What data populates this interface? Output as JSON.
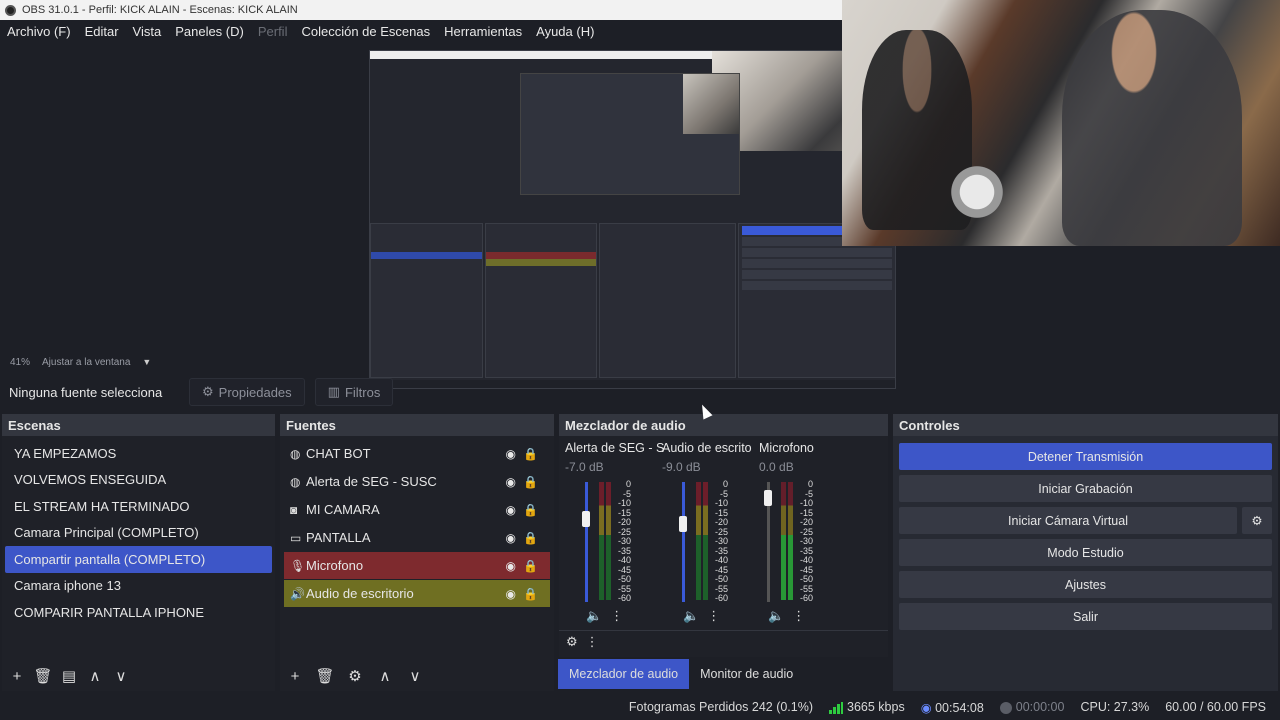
{
  "window": {
    "title": "OBS 31.0.1 - Perfil: KICK ALAIN - Escenas: KICK ALAIN"
  },
  "menu": [
    {
      "label": "Archivo (F)",
      "disabled": false
    },
    {
      "label": "Editar",
      "disabled": false
    },
    {
      "label": "Vista",
      "disabled": false
    },
    {
      "label": "Paneles (D)",
      "disabled": false
    },
    {
      "label": "Perfil",
      "disabled": true
    },
    {
      "label": "Colección de Escenas",
      "disabled": false
    },
    {
      "label": "Herramientas",
      "disabled": false
    },
    {
      "label": "Ayuda (H)",
      "disabled": false
    }
  ],
  "zoom": {
    "percent": "41%",
    "fit_label": "Ajustar a la ventana"
  },
  "source_bar": {
    "label": "Ninguna fuente selecciona",
    "properties": "Propiedades",
    "filters": "Filtros"
  },
  "scenes": {
    "title": "Escenas",
    "items": [
      {
        "label": "YA EMPEZAMOS",
        "selected": false
      },
      {
        "label": "VOLVEMOS ENSEGUIDA",
        "selected": false
      },
      {
        "label": "EL STREAM HA TERMINADO",
        "selected": false
      },
      {
        "label": "Camara Principal (COMPLETO)",
        "selected": false
      },
      {
        "label": "Compartir pantalla (COMPLETO)",
        "selected": true
      },
      {
        "label": "Camara iphone 13",
        "selected": false
      },
      {
        "label": "COMPARIR PANTALLA IPHONE",
        "selected": false
      }
    ]
  },
  "sources": {
    "title": "Fuentes",
    "items": [
      {
        "label": "CHAT BOT",
        "icon": "globe-icon",
        "color": ""
      },
      {
        "label": "Alerta de SEG - SUSC",
        "icon": "globe-icon",
        "color": ""
      },
      {
        "label": "MI CAMARA",
        "icon": "camera-icon",
        "color": ""
      },
      {
        "label": "PANTALLA",
        "icon": "monitor-icon",
        "color": ""
      },
      {
        "label": "Microfono",
        "icon": "microphone-icon",
        "color": "#7e2a2e"
      },
      {
        "label": "Audio de escritorio",
        "icon": "speaker-icon",
        "color": "#6f6f22"
      }
    ]
  },
  "mixer": {
    "title": "Mezclador de audio",
    "channels": [
      {
        "name": "Alerta de SEG - S",
        "db": "-7.0 dB",
        "level": 0.72
      },
      {
        "name": "Audio de escrito",
        "db": "-9.0 dB",
        "level": 0.67
      },
      {
        "name": "Microfono",
        "db": "0.0 dB",
        "level": 0.92
      }
    ],
    "ticks": [
      "0",
      "-5",
      "-10",
      "-15",
      "-20",
      "-25",
      "-30",
      "-35",
      "-40",
      "-45",
      "-50",
      "-55",
      "-60"
    ],
    "tabs": [
      "Mezclador de audio",
      "Monitor de audio"
    ]
  },
  "controls": {
    "title": "Controles",
    "buttons": {
      "stream": "Detener Transmisión",
      "record": "Iniciar Grabación",
      "virtual_cam": "Iniciar Cámara Virtual",
      "studio": "Modo Estudio",
      "settings": "Ajustes",
      "exit": "Salir"
    }
  },
  "status": {
    "dropped": "Fotogramas Perdidos 242 (0.1%)",
    "bitrate": "3665 kbps",
    "stream_time": "00:54:08",
    "rec_time": "00:00:00",
    "cpu": "CPU: 27.3%",
    "fps": "60.00 / 60.00 FPS"
  },
  "colors": {
    "accent": "#3d56c8",
    "mic_source": "#7e2a2e",
    "desktop_source": "#6f6f22"
  }
}
